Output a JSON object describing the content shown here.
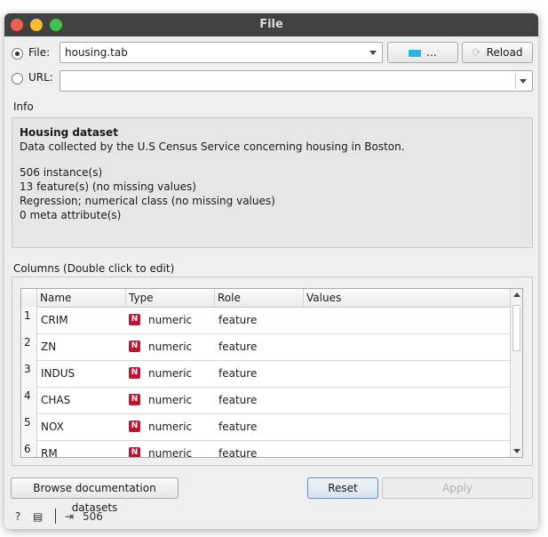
{
  "window": {
    "title": "File"
  },
  "source": {
    "file_label": "File:",
    "file_value": "housing.tab",
    "browse_label": "...",
    "reload_label": "Reload",
    "url_label": "URL:",
    "url_value": ""
  },
  "info": {
    "section_label": "Info",
    "dataset_title": "Housing dataset",
    "description": "Data collected by the U.S Census Service concerning housing in Boston.",
    "instances": "506 instance(s)",
    "features": "13 feature(s) (no missing values)",
    "target": "Regression; numerical class (no missing values)",
    "meta": "0 meta attribute(s)"
  },
  "columns": {
    "section_label": "Columns (Double click to edit)",
    "headers": [
      "Name",
      "Type",
      "Role",
      "Values"
    ],
    "type_badge": "N",
    "rows": [
      {
        "num": "1",
        "name": "CRIM",
        "type": "numeric",
        "role": "feature",
        "values": ""
      },
      {
        "num": "2",
        "name": "ZN",
        "type": "numeric",
        "role": "feature",
        "values": ""
      },
      {
        "num": "3",
        "name": "INDUS",
        "type": "numeric",
        "role": "feature",
        "values": ""
      },
      {
        "num": "4",
        "name": "CHAS",
        "type": "numeric",
        "role": "feature",
        "values": ""
      },
      {
        "num": "5",
        "name": "NOX",
        "type": "numeric",
        "role": "feature",
        "values": ""
      },
      {
        "num": "6",
        "name": "RM",
        "type": "numeric",
        "role": "feature",
        "values": ""
      }
    ]
  },
  "buttons": {
    "browse_docs": "Browse documentation datasets",
    "reset": "Reset",
    "apply": "Apply"
  },
  "status": {
    "output_count": "506"
  },
  "colors": {
    "titlebar": "#414141",
    "accent_blue": "#29b6e8",
    "badge_red": "#c8102e"
  }
}
